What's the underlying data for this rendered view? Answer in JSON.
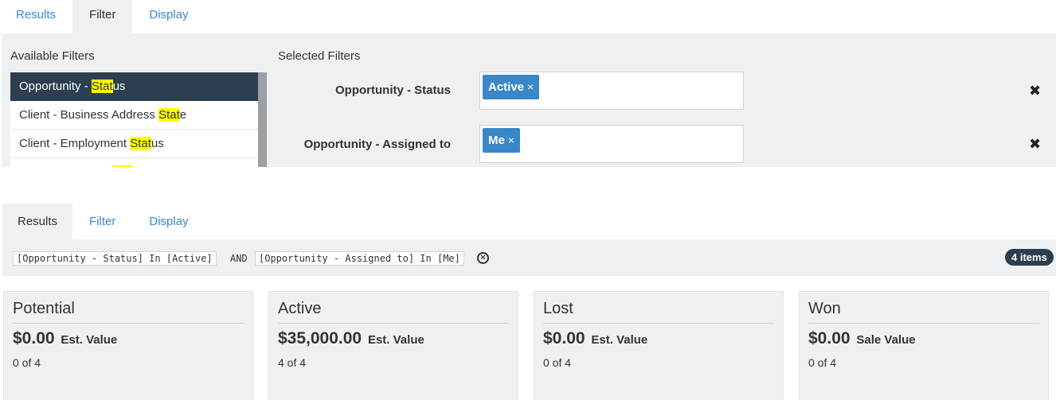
{
  "top_tabs": [
    {
      "label": "Results",
      "active": false
    },
    {
      "label": "Filter",
      "active": true
    },
    {
      "label": "Display",
      "active": false
    }
  ],
  "filter_panel": {
    "available_label": "Available Filters",
    "selected_label": "Selected Filters",
    "available_items": [
      {
        "pre": "Opportunity - ",
        "match": "Stat",
        "post": "us",
        "selected": true
      },
      {
        "pre": "Client - Business Address ",
        "match": "Stat",
        "post": "e",
        "selected": false
      },
      {
        "pre": "Client - Employment ",
        "match": "Stat",
        "post": "us",
        "selected": false
      }
    ],
    "selected_filters": [
      {
        "label": "Opportunity - Status",
        "chip": "Active",
        "chip_close": "×",
        "remove": "✖"
      },
      {
        "label": "Opportunity - Assigned to",
        "chip": "Me",
        "chip_close": "×",
        "remove": "✖"
      }
    ]
  },
  "bottom_tabs": [
    {
      "label": "Results",
      "active": true
    },
    {
      "label": "Filter",
      "active": false
    },
    {
      "label": "Display",
      "active": false
    }
  ],
  "criteria": {
    "expr1": "[Opportunity - Status] In [Active]",
    "joiner": "AND",
    "expr2": "[Opportunity - Assigned to] In [Me]",
    "clear_glyph": "×",
    "count": "4 items"
  },
  "cards": [
    {
      "title": "Potential",
      "amount": "$0.00",
      "amount_label": "Est. Value",
      "count": "0 of 4"
    },
    {
      "title": "Active",
      "amount": "$35,000.00",
      "amount_label": "Est. Value",
      "count": "4 of 4"
    },
    {
      "title": "Lost",
      "amount": "$0.00",
      "amount_label": "Est. Value",
      "count": "0 of 4"
    },
    {
      "title": "Won",
      "amount": "$0.00",
      "amount_label": "Sale Value",
      "count": "0 of 4"
    }
  ],
  "colors": {
    "accent": "#3a87c8",
    "dark": "#2c3e50",
    "highlight": "#ffff00",
    "panel": "#eef0f1"
  }
}
